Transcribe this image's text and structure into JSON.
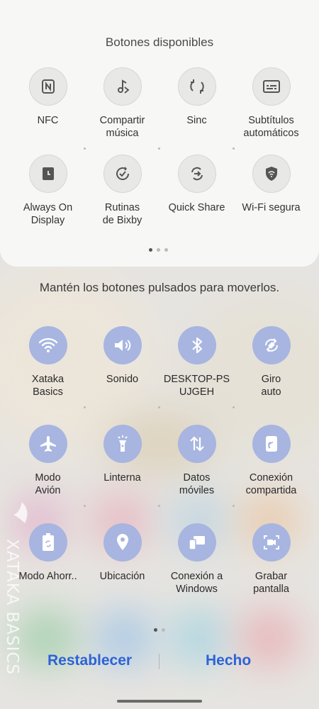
{
  "available": {
    "title": "Botones disponibles",
    "buttons": [
      {
        "label": "NFC",
        "icon": "nfc-icon"
      },
      {
        "label": "Compartir\nmúsica",
        "icon": "music-share-icon"
      },
      {
        "label": "Sinc",
        "icon": "sync-icon"
      },
      {
        "label": "Subtítulos\nautomáticos",
        "icon": "subtitles-icon"
      },
      {
        "label": "Always On\nDisplay",
        "icon": "always-on-display-icon"
      },
      {
        "label": "Rutinas\nde Bixby",
        "icon": "bixby-routines-icon"
      },
      {
        "label": "Quick Share",
        "icon": "quick-share-icon"
      },
      {
        "label": "Wi-Fi segura",
        "icon": "secure-wifi-icon"
      }
    ]
  },
  "hint": "Mantén los botones pulsados para moverlos.",
  "active": {
    "buttons": [
      {
        "label": "Xataka\nBasics",
        "icon": "wifi-icon"
      },
      {
        "label": "Sonido",
        "icon": "sound-icon"
      },
      {
        "label": "DESKTOP-PS\nUJGEH",
        "icon": "bluetooth-icon"
      },
      {
        "label": "Giro\nauto",
        "icon": "auto-rotate-icon"
      },
      {
        "label": "Modo\nAvión",
        "icon": "airplane-icon"
      },
      {
        "label": "Linterna",
        "icon": "flashlight-icon"
      },
      {
        "label": "Datos\nmóviles",
        "icon": "mobile-data-icon"
      },
      {
        "label": "Conexión\ncompartida",
        "icon": "hotspot-icon"
      },
      {
        "label": "Modo Ahorr..",
        "icon": "power-saving-icon"
      },
      {
        "label": "Ubicación",
        "icon": "location-icon"
      },
      {
        "label": "Conexión a\nWindows",
        "icon": "link-to-windows-icon"
      },
      {
        "label": "Grabar\npantalla",
        "icon": "screen-record-icon"
      }
    ]
  },
  "footer": {
    "reset_label": "Restablecer",
    "done_label": "Hecho"
  },
  "watermark": "XATAKA BASICS",
  "colors": {
    "accent": "#2d63d6",
    "active_tile": "#a7b5e0",
    "panel": "#f7f7f5"
  }
}
